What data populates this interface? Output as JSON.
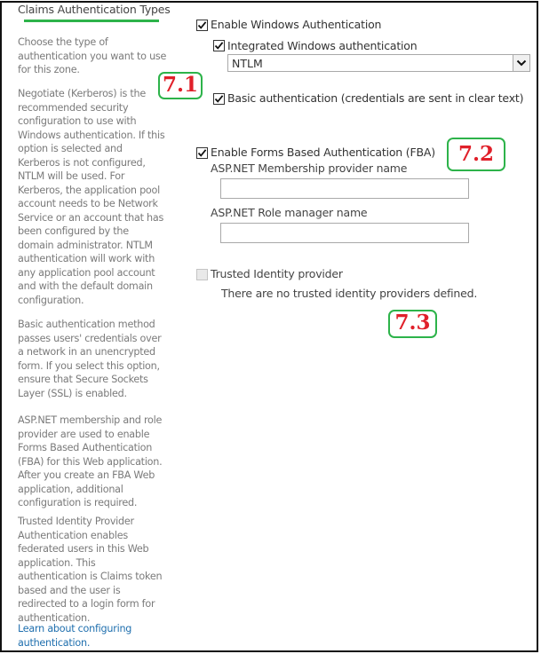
{
  "section": {
    "title": "Claims Authentication Types",
    "accent_color": "#2db34a"
  },
  "descriptions": [
    "Choose the type of authentication you want to use for this zone.",
    "Negotiate (Kerberos) is the recommended security configuration to use with Windows authentication. If this option is selected and Kerberos is not configured, NTLM will be used. For Kerberos, the application pool account needs to be Network Service or an account that has been configured by the domain administrator. NTLM authentication will work with any application pool account and with the default domain configuration.",
    "Basic authentication method passes users' credentials over a network in an unencrypted form. If you select this option, ensure that Secure Sockets Layer (SSL) is enabled.",
    "ASP.NET membership and role provider are used to enable Forms Based Authentication (FBA) for this Web application. After you create an FBA Web application, additional configuration is required.",
    "Trusted Identity Provider Authentication enables federated users in this Web application. This authentication is Claims token based and the user is redirected to a login form for authentication."
  ],
  "learn_link": "Learn about configuring authentication.",
  "windows_auth": {
    "label": "Enable Windows Authentication",
    "checked": true,
    "integrated": {
      "label": "Integrated Windows authentication",
      "checked": true,
      "select_value": "NTLM"
    },
    "basic": {
      "label": "Basic authentication (credentials are sent in clear text)",
      "checked": true
    }
  },
  "fba": {
    "label": "Enable Forms Based Authentication (FBA)",
    "checked": true,
    "membership_label": "ASP.NET Membership provider name",
    "membership_value": "",
    "role_label": "ASP.NET Role manager name",
    "role_value": ""
  },
  "trusted": {
    "label": "Trusted Identity provider",
    "checked": false,
    "disabled": true,
    "message": "There are no trusted identity providers defined."
  },
  "annotations": {
    "a1": "7.1",
    "a2": "7.2",
    "a3": "7.3",
    "text_color": "#e0202a",
    "border_color": "#2db34a"
  }
}
